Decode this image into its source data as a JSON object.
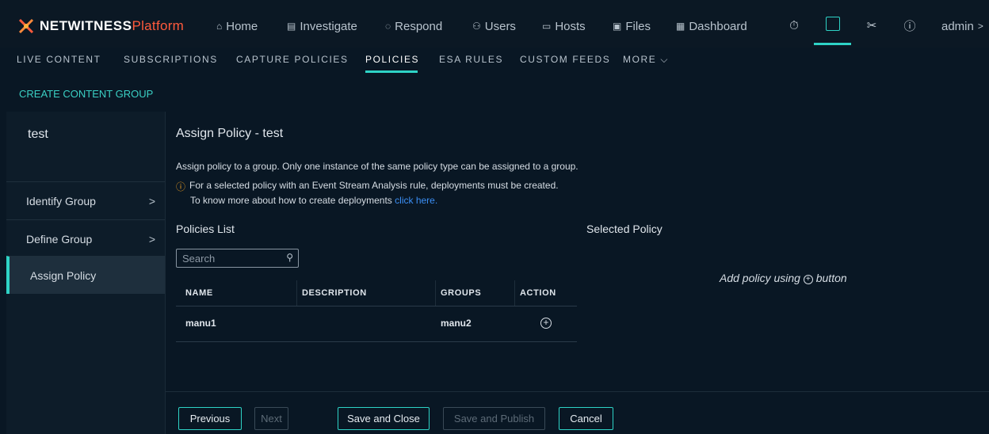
{
  "brand": {
    "name": "NETWITNESS",
    "product": "Platform"
  },
  "topnav": [
    {
      "label": "Home",
      "icon": "home-icon"
    },
    {
      "label": "Investigate",
      "icon": "investigate-icon"
    },
    {
      "label": "Respond",
      "icon": "shield-icon"
    },
    {
      "label": "Users",
      "icon": "users-icon"
    },
    {
      "label": "Hosts",
      "icon": "hosts-icon"
    },
    {
      "label": "Files",
      "icon": "files-icon"
    },
    {
      "label": "Dashboard",
      "icon": "dashboard-icon"
    }
  ],
  "utilities": {
    "user": "admin",
    "user_chevron": ">"
  },
  "subnav": [
    "LIVE CONTENT",
    "SUBSCRIPTIONS",
    "CAPTURE POLICIES",
    "POLICIES",
    "ESA RULES",
    "CUSTOM FEEDS",
    "MORE"
  ],
  "subnav_active": "POLICIES",
  "create_group_label": "CREATE CONTENT GROUP",
  "wizard": {
    "group_name": "test",
    "steps": [
      {
        "label": "Identify Group",
        "chevron": ">"
      },
      {
        "label": "Define Group",
        "chevron": ">"
      },
      {
        "label": "Assign Policy"
      }
    ]
  },
  "main": {
    "title": "Assign Policy - test",
    "description": "Assign policy to a group. Only one instance of the same policy type can be assigned to a group.",
    "warning_line1": "For a selected policy with an Event Stream Analysis rule, deployments must be created.",
    "warning_line2": "To know more about how to create deployments",
    "warning_link": "click here.",
    "policies_list_label": "Policies List",
    "selected_policy_label": "Selected Policy",
    "search_placeholder": "Search",
    "table": {
      "headers": [
        "NAME",
        "DESCRIPTION",
        "GROUPS",
        "ACTION"
      ],
      "rows": [
        {
          "name": "manu1",
          "description": "",
          "groups": "manu2"
        }
      ]
    },
    "empty_selected_pre": "Add policy using",
    "empty_selected_post": "button"
  },
  "footer": {
    "previous": "Previous",
    "next": "Next",
    "save_close": "Save and Close",
    "save_publish": "Save and Publish",
    "cancel": "Cancel"
  },
  "colors": {
    "accent": "#2ed3c6",
    "brand_orange": "#ff5a3c",
    "link": "#3b8ff5",
    "warning": "#f0a020"
  }
}
